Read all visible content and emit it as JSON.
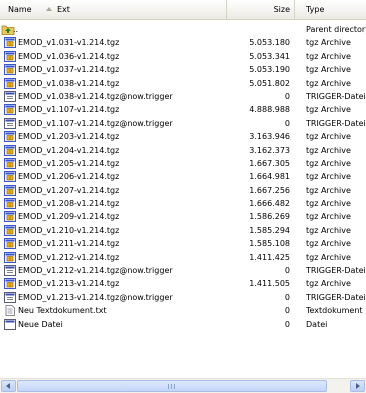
{
  "header": {
    "name_label": "Name",
    "ext_label": "Ext",
    "size_label": "Size",
    "type_label": "Type"
  },
  "rows": [
    {
      "kind": "parent",
      "name": "..",
      "size": "",
      "type": "Parent directory"
    },
    {
      "kind": "archive",
      "name": "EMOD_v1.031-v1.214.tgz",
      "size": "5.053.180",
      "type": "tgz Archive"
    },
    {
      "kind": "archive",
      "name": "EMOD_v1.036-v1.214.tgz",
      "size": "5.053.341",
      "type": "tgz Archive"
    },
    {
      "kind": "archive",
      "name": "EMOD_v1.037-v1.214.tgz",
      "size": "5.053.190",
      "type": "tgz Archive"
    },
    {
      "kind": "archive",
      "name": "EMOD_v1.038-v1.214.tgz",
      "size": "5.051.802",
      "type": "tgz Archive"
    },
    {
      "kind": "trigger",
      "name": "EMOD_v1.038-v1.214.tgz@now.trigger",
      "size": "0",
      "type": "TRIGGER-Datei"
    },
    {
      "kind": "archive",
      "name": "EMOD_v1.107-v1.214.tgz",
      "size": "4.888.988",
      "type": "tgz Archive"
    },
    {
      "kind": "trigger",
      "name": "EMOD_v1.107-v1.214.tgz@now.trigger",
      "size": "0",
      "type": "TRIGGER-Datei"
    },
    {
      "kind": "archive",
      "name": "EMOD_v1.203-v1.214.tgz",
      "size": "3.163.946",
      "type": "tgz Archive"
    },
    {
      "kind": "archive",
      "name": "EMOD_v1.204-v1.214.tgz",
      "size": "3.162.373",
      "type": "tgz Archive"
    },
    {
      "kind": "archive",
      "name": "EMOD_v1.205-v1.214.tgz",
      "size": "1.667.305",
      "type": "tgz Archive"
    },
    {
      "kind": "archive",
      "name": "EMOD_v1.206-v1.214.tgz",
      "size": "1.664.981",
      "type": "tgz Archive"
    },
    {
      "kind": "archive",
      "name": "EMOD_v1.207-v1.214.tgz",
      "size": "1.667.256",
      "type": "tgz Archive"
    },
    {
      "kind": "archive",
      "name": "EMOD_v1.208-v1.214.tgz",
      "size": "1.666.482",
      "type": "tgz Archive"
    },
    {
      "kind": "archive",
      "name": "EMOD_v1.209-v1.214.tgz",
      "size": "1.586.269",
      "type": "tgz Archive"
    },
    {
      "kind": "archive",
      "name": "EMOD_v1.210-v1.214.tgz",
      "size": "1.585.294",
      "type": "tgz Archive"
    },
    {
      "kind": "archive",
      "name": "EMOD_v1.211-v1.214.tgz",
      "size": "1.585.108",
      "type": "tgz Archive"
    },
    {
      "kind": "archive",
      "name": "EMOD_v1.212-v1.214.tgz",
      "size": "1.411.425",
      "type": "tgz Archive"
    },
    {
      "kind": "trigger",
      "name": "EMOD_v1.212-v1.214.tgz@now.trigger",
      "size": "0",
      "type": "TRIGGER-Datei"
    },
    {
      "kind": "archive",
      "name": "EMOD_v1.213-v1.214.tgz",
      "size": "1.411.505",
      "type": "tgz Archive"
    },
    {
      "kind": "trigger",
      "name": "EMOD_v1.213-v1.214.tgz@now.trigger",
      "size": "0",
      "type": "TRIGGER-Datei"
    },
    {
      "kind": "text",
      "name": "Neu Textdokument.txt",
      "size": "0",
      "type": "Textdokument"
    },
    {
      "kind": "file",
      "name": "Neue Datei",
      "size": "0",
      "type": "Datei"
    }
  ],
  "icons": {
    "parent": "folder-up-icon",
    "archive": "archive-file-icon",
    "trigger": "trigger-file-icon",
    "text": "text-document-icon",
    "file": "generic-file-icon"
  },
  "colors": {
    "archive_accent": "#e8b020",
    "archive_frame": "#3a57c8",
    "folder": "#e9c95a"
  }
}
